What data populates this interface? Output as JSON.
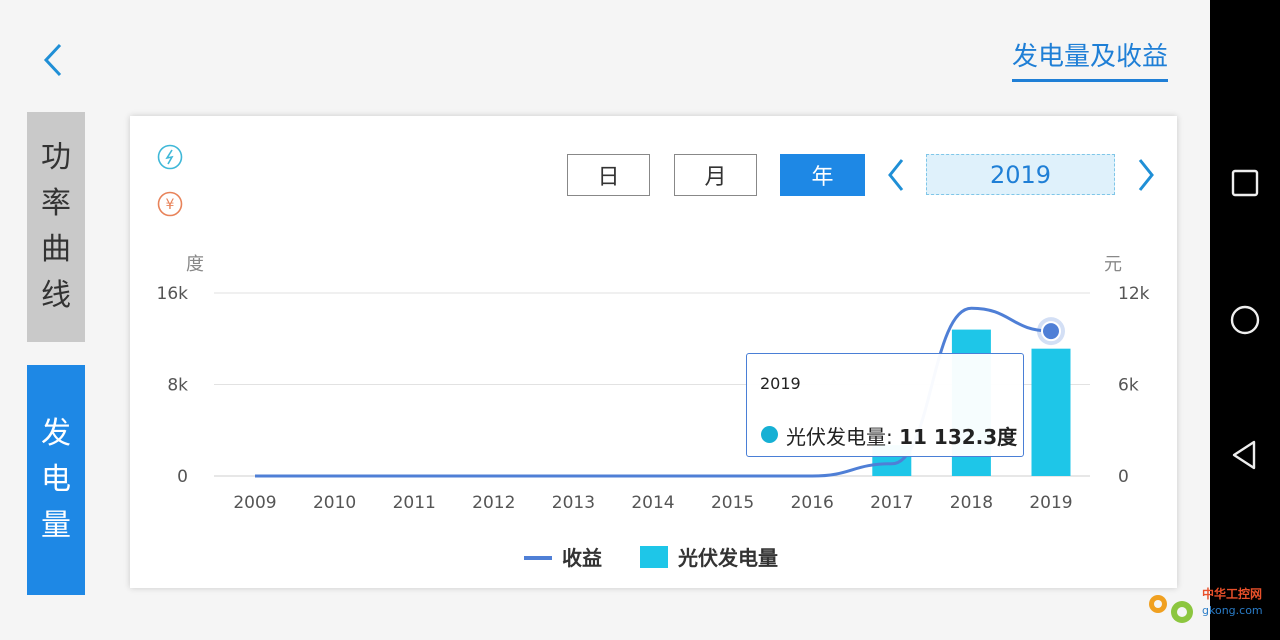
{
  "header": {
    "back_icon": "chevron-left-icon",
    "title": "发电量及收益"
  },
  "sidebar": {
    "tabs": [
      {
        "label": [
          "功",
          "率",
          "曲",
          "线"
        ],
        "active": false
      },
      {
        "label": [
          "发",
          "电",
          "量"
        ],
        "active": true
      }
    ]
  },
  "toolbar": {
    "icons": [
      "lightning-circle-icon",
      "yen-circle-icon"
    ],
    "period_buttons": [
      "日",
      "月",
      "年"
    ],
    "selected_period": "年",
    "year": "2019",
    "prev_icon": "chevron-left-icon",
    "next_icon": "chevron-right-icon"
  },
  "chart_data": {
    "type": "bar",
    "categories": [
      "2009",
      "2010",
      "2011",
      "2012",
      "2013",
      "2014",
      "2015",
      "2016",
      "2017",
      "2018",
      "2019"
    ],
    "y_left_unit": "度",
    "y_right_unit": "元",
    "y_left_ticks": [
      "0",
      "8k",
      "16k"
    ],
    "y_right_ticks": [
      "0",
      "6k",
      "12k"
    ],
    "ylim_left": [
      0,
      16000
    ],
    "ylim_right": [
      0,
      12000
    ],
    "grid": true,
    "legend_position": "bottom",
    "series": [
      {
        "name": "光伏发电量",
        "kind": "bar",
        "axis": "left",
        "color": "#1ec6e8",
        "values": [
          0,
          0,
          0,
          0,
          0,
          0,
          0,
          0,
          2700,
          12800,
          11132.3
        ]
      },
      {
        "name": "收益",
        "kind": "line",
        "axis": "right",
        "color": "#4f7fd6",
        "values": [
          0,
          0,
          0,
          0,
          0,
          0,
          0,
          0,
          800,
          11000,
          9500
        ]
      }
    ],
    "highlight": {
      "category": "2019",
      "series_name": "光伏发电量",
      "value": "11 132.3",
      "unit": "度"
    }
  },
  "tooltip": {
    "title": "2019",
    "label": "光伏发电量: ",
    "value": "11 132.3度"
  },
  "android_nav": {
    "icons": [
      "recents-square-icon",
      "home-circle-icon",
      "back-triangle-icon"
    ]
  },
  "watermark": {
    "text": "中华工控网",
    "url_text": "gkong.com"
  }
}
